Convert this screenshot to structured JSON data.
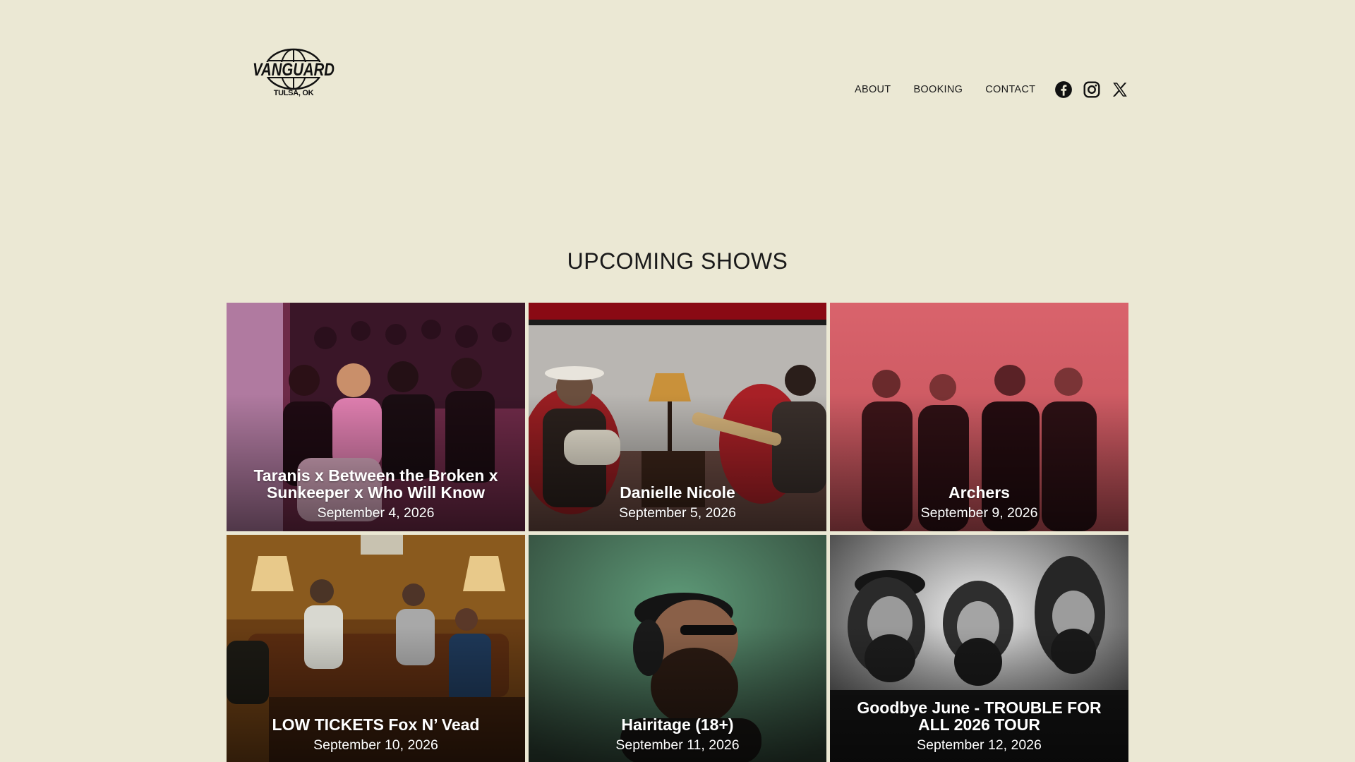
{
  "header": {
    "logo_text": "VANGUARD",
    "logo_subtext": "TULSA, OK",
    "nav": [
      {
        "label": "ABOUT"
      },
      {
        "label": "BOOKING"
      },
      {
        "label": "CONTACT"
      }
    ],
    "social_icons": [
      "facebook-icon",
      "instagram-icon",
      "x-icon"
    ]
  },
  "main": {
    "section_title": "UPCOMING SHOWS",
    "shows": [
      {
        "title": "Taranis x Between the Broken x Sunkeeper x Who Will Know",
        "date": "September 4, 2026"
      },
      {
        "title": "Danielle Nicole",
        "date": "September 5, 2026"
      },
      {
        "title": "Archers",
        "date": "September 9, 2026"
      },
      {
        "title": "LOW TICKETS Fox N’ Vead",
        "date": "September 10, 2026"
      },
      {
        "title": "Hairitage (18+)",
        "date": "September 11, 2026"
      },
      {
        "title": "Goodbye June - TROUBLE FOR ALL 2026 TOUR",
        "date": "September 12, 2026"
      }
    ]
  },
  "colors": {
    "background": "#ebe8d4",
    "text": "#1a1a1a",
    "caption_text": "#ffffff"
  }
}
